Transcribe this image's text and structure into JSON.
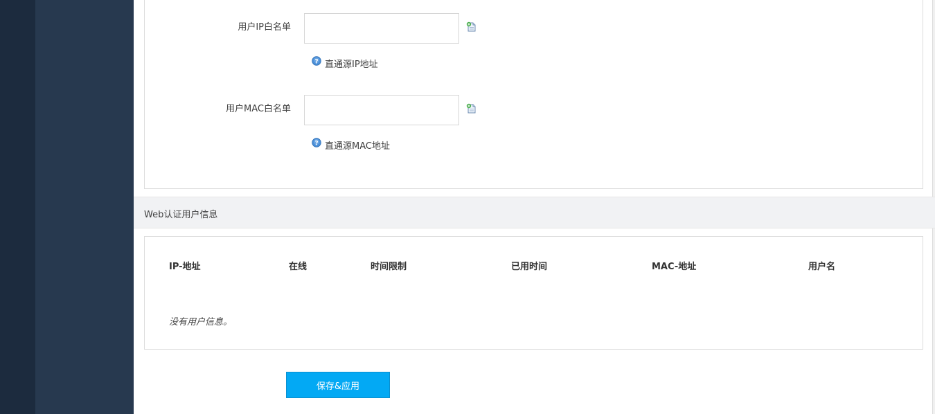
{
  "whitelist": {
    "ip": {
      "label": "用户IP白名单",
      "value": "",
      "hint": "直通源IP地址",
      "add_icon": "add-entry-icon",
      "hint_icon": "question-icon"
    },
    "mac": {
      "label": "用户MAC白名单",
      "value": "",
      "hint": "直通源MAC地址",
      "add_icon": "add-entry-icon",
      "hint_icon": "question-icon"
    }
  },
  "web_auth": {
    "title": "Web认证用户信息",
    "columns": [
      "IP-地址",
      "在线",
      "时间限制",
      "已用时间",
      "MAC-地址",
      "用户名"
    ],
    "rows": [],
    "empty_message": "没有用户信息。"
  },
  "actions": {
    "save_apply_label": "保存&应用"
  },
  "colors": {
    "sidebar_dark": "#1c2b3e",
    "sidebar": "#27394f",
    "section_header_bg": "#f1f2f4",
    "primary_button": "#03a9f4"
  }
}
